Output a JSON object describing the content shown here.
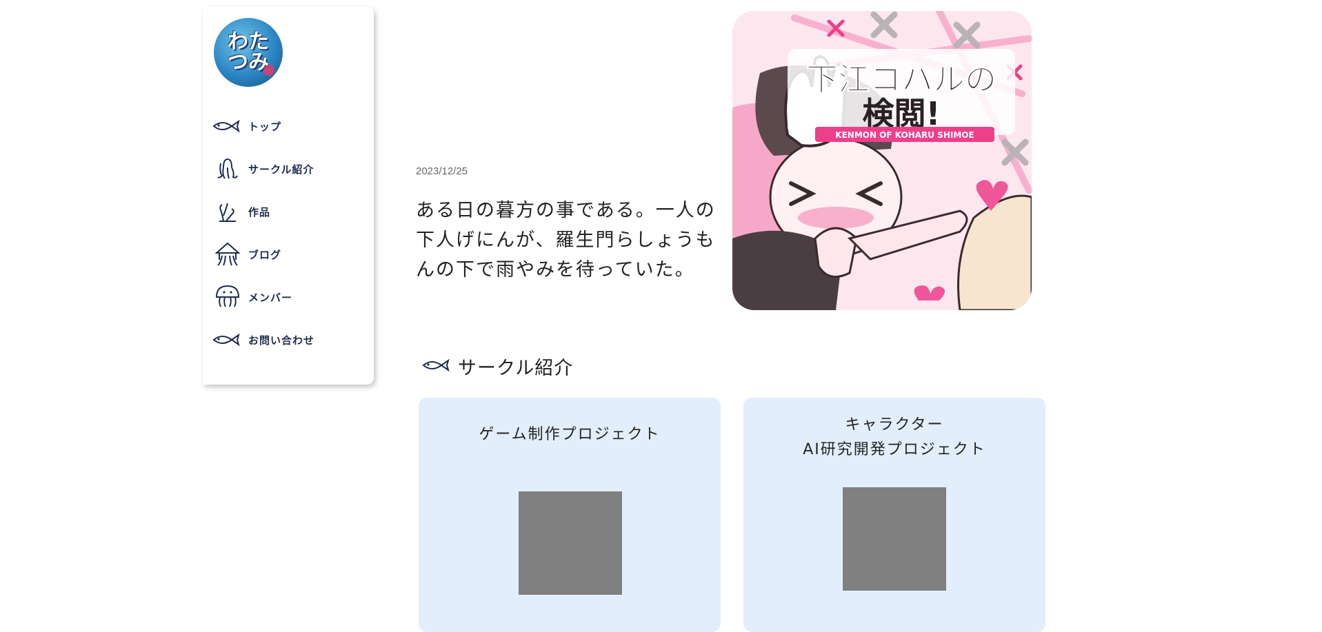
{
  "logo": {
    "text": "わたつみ"
  },
  "nav": {
    "items": [
      {
        "label": "トップ",
        "icon": "fish-icon"
      },
      {
        "label": "サークル紹介",
        "icon": "octopus-icon"
      },
      {
        "label": "作品",
        "icon": "coral-icon"
      },
      {
        "label": "ブログ",
        "icon": "squid-icon"
      },
      {
        "label": "メンバー",
        "icon": "jellyfish-icon"
      },
      {
        "label": "お問い合わせ",
        "icon": "fish-icon"
      }
    ]
  },
  "hero": {
    "date": "2023/12/25",
    "text": "ある日の暮方の事である。一人の下人げにんが、羅生門らしょうもんの下で雨やみを待っていた。",
    "image": {
      "title_text": "下江コハルの検閲!",
      "subtitle_text": "KENMON OF KOHARU SHIMOE"
    }
  },
  "section": {
    "title": "サークル紹介",
    "cards": [
      {
        "title": "ゲーム制作プロジェクト"
      },
      {
        "title_line1": "キャラクター",
        "title_line2": "AI研究開発プロジェクト"
      }
    ]
  },
  "colors": {
    "nav_text": "#1d2b4f",
    "card_bg": "#e3eefc",
    "placeholder": "#808080",
    "accent_pink": "#f0579a"
  }
}
